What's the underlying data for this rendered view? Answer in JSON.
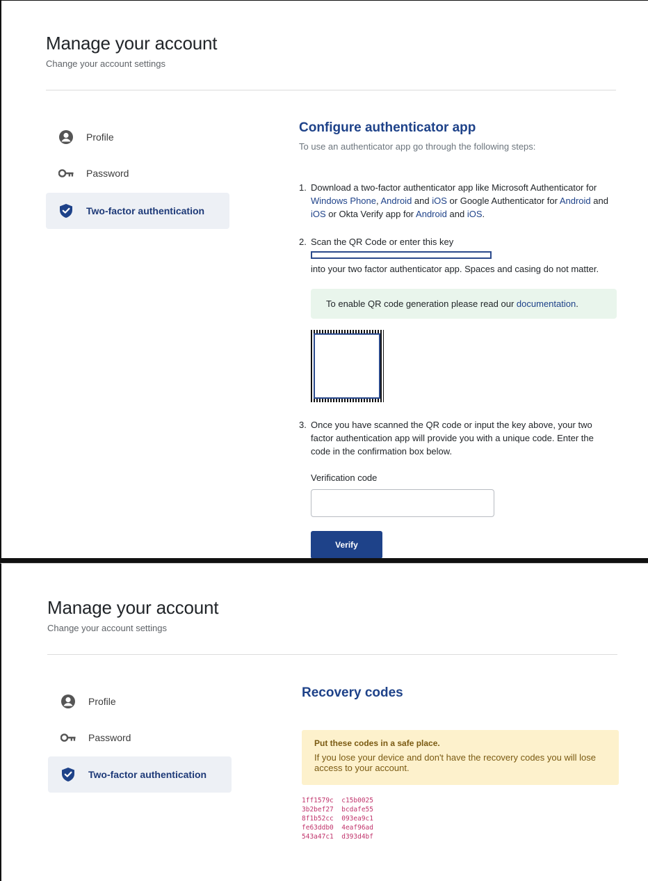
{
  "header": {
    "title": "Manage your account",
    "subtitle": "Change your account settings"
  },
  "nav": {
    "items": [
      {
        "label": "Profile",
        "icon": "user-circle-icon"
      },
      {
        "label": "Password",
        "icon": "key-icon"
      },
      {
        "label": "Two-factor authentication",
        "icon": "shield-check-icon"
      }
    ]
  },
  "authenticator": {
    "title": "Configure authenticator app",
    "description": "To use an authenticator app go through the following steps:",
    "step1": {
      "number": "1.",
      "line1_prefix": "Download a two-factor authenticator app like Microsoft Authenticator for",
      "link_windows_phone": "Windows Phone",
      "comma": ",",
      "link_android_1": "Android",
      "and_1": "and",
      "link_ios_1": "iOS",
      "or_google": "or Google Authenticator for",
      "link_android_2": "Android",
      "and_2": "and",
      "link_ios_2": "iOS",
      "or_okta": "or Okta Verify app for",
      "link_android_3": "Android",
      "and_3": "and",
      "link_ios_3": "iOS",
      "period": "."
    },
    "step2": {
      "number": "2.",
      "line1": "Scan the QR Code or enter this key",
      "line2": "into your two factor authenticator app. Spaces and casing do not matter."
    },
    "qr_notice": {
      "prefix": "To enable QR code generation please read our",
      "link": "documentation",
      "suffix": "."
    },
    "step3": {
      "number": "3.",
      "line1": "Once you have scanned the QR code or input the key above, your two",
      "line2": "factor authentication app will provide you with a unique code. Enter the",
      "line3": "code in the confirmation box below."
    },
    "verification_label": "Verification code",
    "verification_value": "",
    "verify_button": "Verify"
  },
  "recovery": {
    "title": "Recovery codes",
    "warning_heading": "Put these codes in a safe place.",
    "warning_text": "If you lose your device and don't have the recovery codes you will lose access to your account.",
    "codes": [
      [
        "1ff1579c",
        "c15b0025"
      ],
      [
        "3b2bef27",
        "bcdafe55"
      ],
      [
        "8f1b52cc",
        "093ea9c1"
      ],
      [
        "fe63ddb0",
        "4eaf96ad"
      ],
      [
        "543a47c1",
        "d393d4bf"
      ]
    ]
  },
  "colors": {
    "accent": "#1e4289",
    "active_nav_bg": "#edf0f5",
    "success_bg": "#e9f5ec",
    "warning_bg": "#fdf1cc",
    "code_color": "#c0336b"
  }
}
